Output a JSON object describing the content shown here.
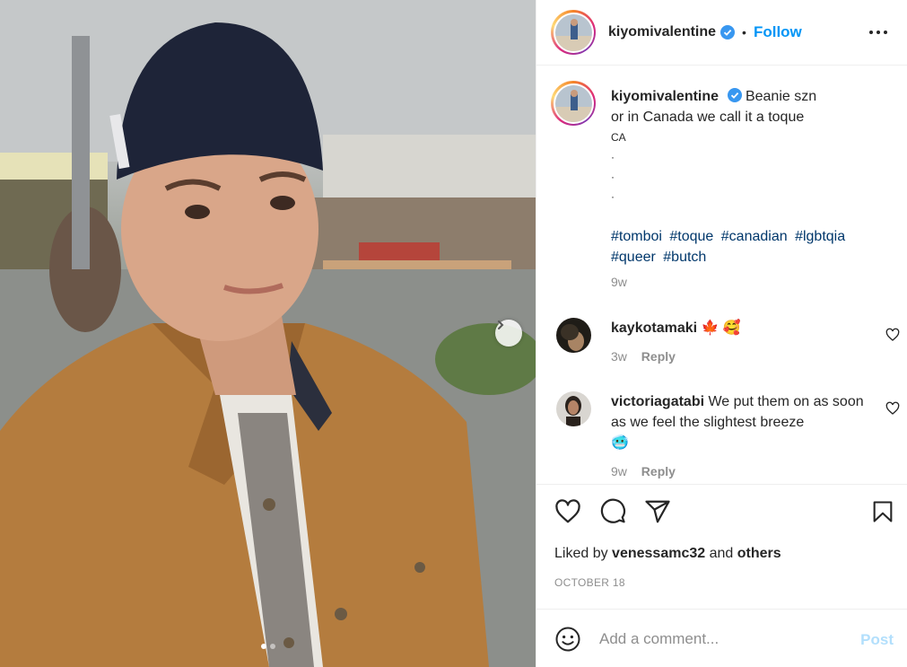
{
  "post": {
    "username": "kiyomivalentine",
    "follow_label": "Follow",
    "separator": "•",
    "caption_line1": "Beanie szn",
    "caption_line2": "or in Canada we call it a toque",
    "caption_flag": "CA",
    "caption_dots": [
      "·",
      "·",
      "·"
    ],
    "hashtags": [
      "#tomboi",
      "#toque",
      "#canadian",
      "#lgbtqia",
      "#queer",
      "#butch"
    ],
    "caption_time": "9w",
    "carousel": {
      "slides": 2,
      "active_slide": 1
    }
  },
  "comments": [
    {
      "username": "kaykotamaki",
      "text": "🍁 🥰",
      "time": "3w",
      "reply_label": "Reply"
    },
    {
      "username": "victoriagatabi",
      "text": "We put them on as soon as we feel the slightest breeze",
      "emoji": "🥶",
      "time": "9w",
      "reply_label": "Reply"
    }
  ],
  "actions": {
    "icons": [
      "heart-icon",
      "comment-icon",
      "share-icon",
      "bookmark-icon"
    ]
  },
  "likes": {
    "prefix": "Liked by",
    "user": "venessamc32",
    "conj": "and",
    "others": "others"
  },
  "date": "OCTOBER 18",
  "add_comment": {
    "placeholder": "Add a comment...",
    "post_label": "Post"
  },
  "colors": {
    "accent": "#0095f6",
    "link": "#00376b",
    "muted": "#8e8e8e",
    "verified": "#3897f0",
    "post_disabled": "#b2dffc"
  }
}
